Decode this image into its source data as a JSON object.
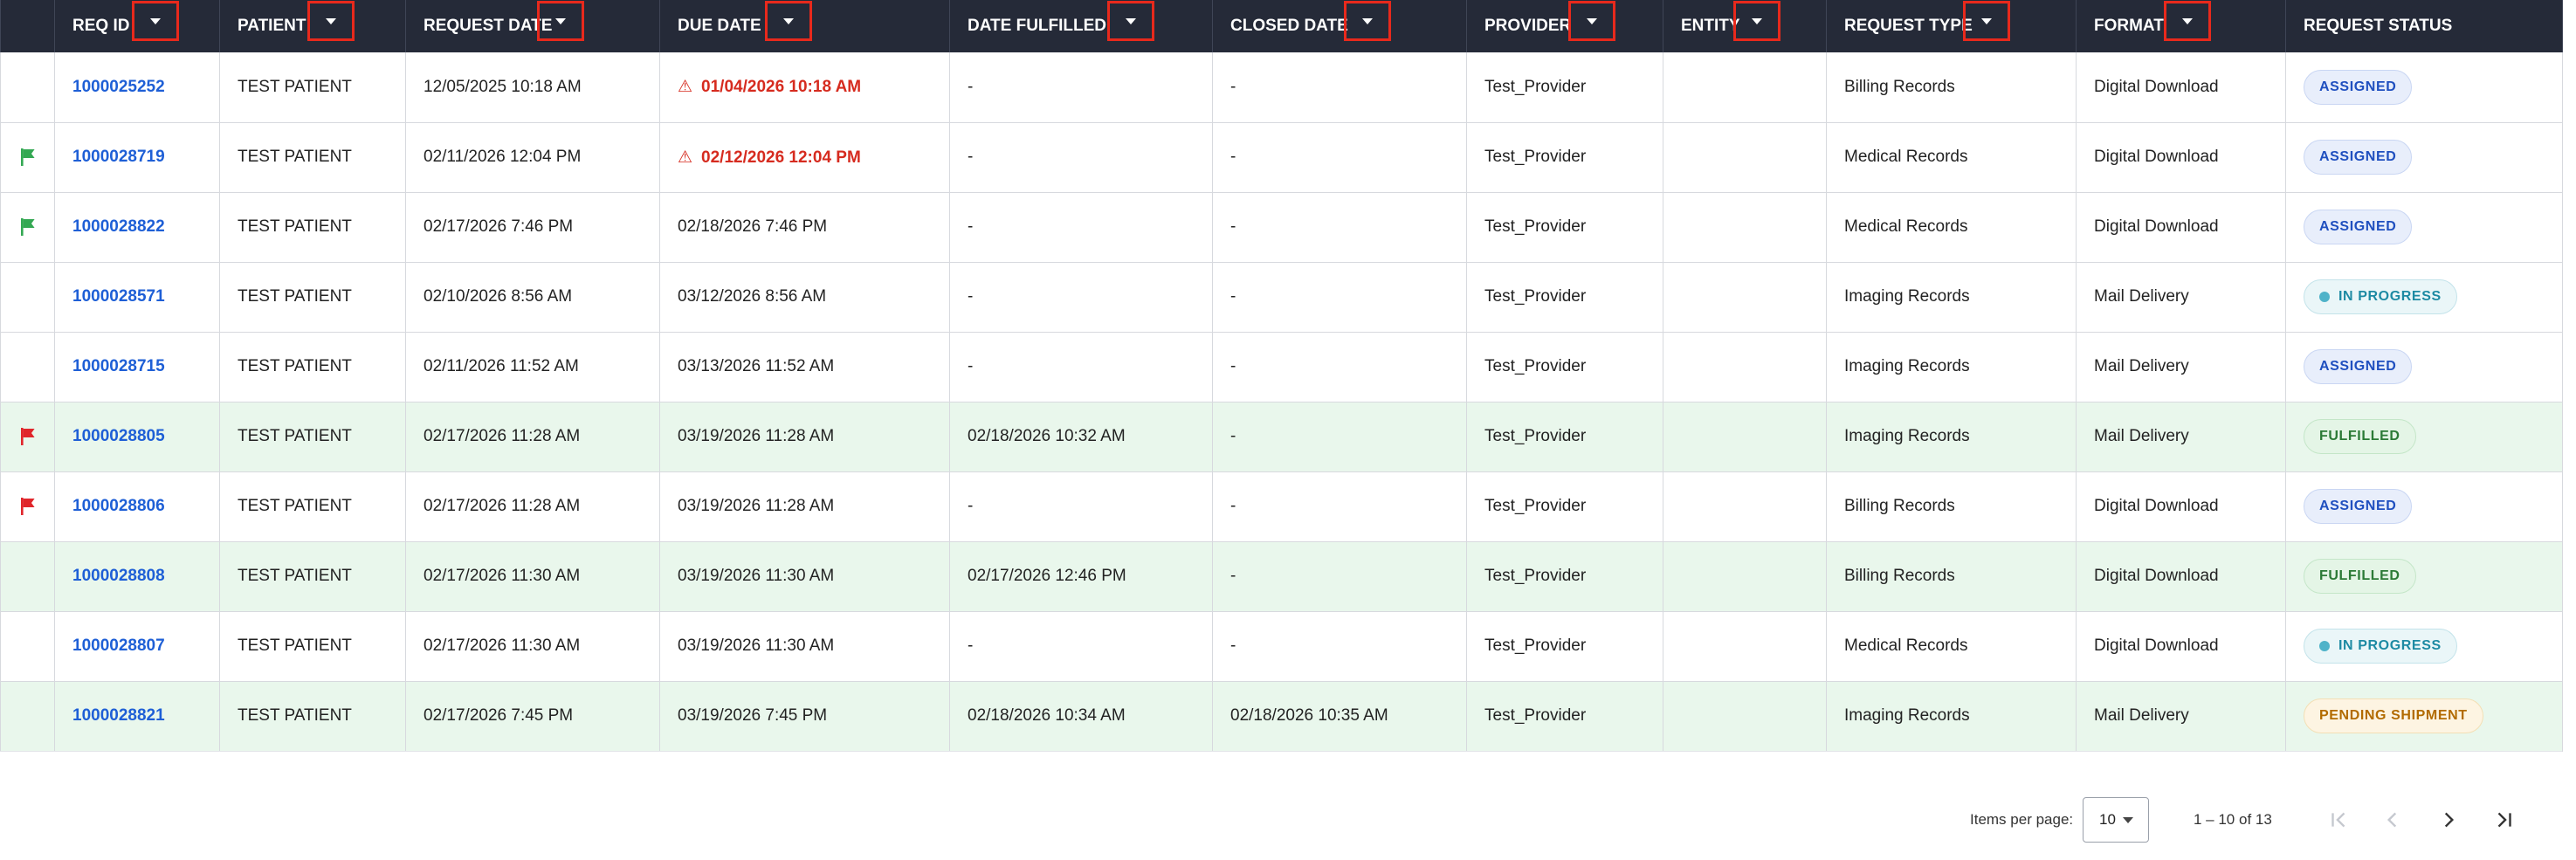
{
  "table": {
    "columns": [
      {
        "key": "flag",
        "label": ""
      },
      {
        "key": "req_id",
        "label": "REQ ID"
      },
      {
        "key": "patient",
        "label": "PATIENT"
      },
      {
        "key": "request_date",
        "label": "REQUEST DATE"
      },
      {
        "key": "due_date",
        "label": "DUE DATE"
      },
      {
        "key": "date_fulfilled",
        "label": "DATE FULFILLED"
      },
      {
        "key": "closed_date",
        "label": "CLOSED DATE"
      },
      {
        "key": "provider",
        "label": "PROVIDER"
      },
      {
        "key": "entity",
        "label": "ENTITY"
      },
      {
        "key": "request_type",
        "label": "REQUEST TYPE"
      },
      {
        "key": "format",
        "label": "FORMAT"
      },
      {
        "key": "request_status",
        "label": "REQUEST STATUS"
      }
    ],
    "rows": [
      {
        "flag": "",
        "req_id": "1000025252",
        "patient": "TEST PATIENT",
        "request_date": "12/05/2025 10:18 AM",
        "due_date": "01/04/2026 10:18 AM",
        "due_overdue": true,
        "date_fulfilled": "-",
        "closed_date": "-",
        "provider": "Test_Provider",
        "entity": "",
        "request_type": "Billing Records",
        "format": "Digital Download",
        "status": "ASSIGNED",
        "status_kind": "assigned",
        "highlight": false
      },
      {
        "flag": "green",
        "req_id": "1000028719",
        "patient": "TEST PATIENT",
        "request_date": "02/11/2026 12:04 PM",
        "due_date": "02/12/2026 12:04 PM",
        "due_overdue": true,
        "date_fulfilled": "-",
        "closed_date": "-",
        "provider": "Test_Provider",
        "entity": "",
        "request_type": "Medical Records",
        "format": "Digital Download",
        "status": "ASSIGNED",
        "status_kind": "assigned",
        "highlight": false
      },
      {
        "flag": "green",
        "req_id": "1000028822",
        "patient": "TEST PATIENT",
        "request_date": "02/17/2026 7:46 PM",
        "due_date": "02/18/2026 7:46 PM",
        "due_overdue": false,
        "date_fulfilled": "-",
        "closed_date": "-",
        "provider": "Test_Provider",
        "entity": "",
        "request_type": "Medical Records",
        "format": "Digital Download",
        "status": "ASSIGNED",
        "status_kind": "assigned",
        "highlight": false
      },
      {
        "flag": "",
        "req_id": "1000028571",
        "patient": "TEST PATIENT",
        "request_date": "02/10/2026 8:56 AM",
        "due_date": "03/12/2026 8:56 AM",
        "due_overdue": false,
        "date_fulfilled": "-",
        "closed_date": "-",
        "provider": "Test_Provider",
        "entity": "",
        "request_type": "Imaging Records",
        "format": "Mail Delivery",
        "status": "IN PROGRESS",
        "status_kind": "in-progress",
        "highlight": false
      },
      {
        "flag": "",
        "req_id": "1000028715",
        "patient": "TEST PATIENT",
        "request_date": "02/11/2026 11:52 AM",
        "due_date": "03/13/2026 11:52 AM",
        "due_overdue": false,
        "date_fulfilled": "-",
        "closed_date": "-",
        "provider": "Test_Provider",
        "entity": "",
        "request_type": "Imaging Records",
        "format": "Mail Delivery",
        "status": "ASSIGNED",
        "status_kind": "assigned",
        "highlight": false
      },
      {
        "flag": "red",
        "req_id": "1000028805",
        "patient": "TEST PATIENT",
        "request_date": "02/17/2026 11:28 AM",
        "due_date": "03/19/2026 11:28 AM",
        "due_overdue": false,
        "date_fulfilled": "02/18/2026 10:32 AM",
        "closed_date": "-",
        "provider": "Test_Provider",
        "entity": "",
        "request_type": "Imaging Records",
        "format": "Mail Delivery",
        "status": "FULFILLED",
        "status_kind": "fulfilled",
        "highlight": true
      },
      {
        "flag": "red",
        "req_id": "1000028806",
        "patient": "TEST PATIENT",
        "request_date": "02/17/2026 11:28 AM",
        "due_date": "03/19/2026 11:28 AM",
        "due_overdue": false,
        "date_fulfilled": "-",
        "closed_date": "-",
        "provider": "Test_Provider",
        "entity": "",
        "request_type": "Billing Records",
        "format": "Digital Download",
        "status": "ASSIGNED",
        "status_kind": "assigned",
        "highlight": false
      },
      {
        "flag": "",
        "req_id": "1000028808",
        "patient": "TEST PATIENT",
        "request_date": "02/17/2026 11:30 AM",
        "due_date": "03/19/2026 11:30 AM",
        "due_overdue": false,
        "date_fulfilled": "02/17/2026 12:46 PM",
        "closed_date": "-",
        "provider": "Test_Provider",
        "entity": "",
        "request_type": "Billing Records",
        "format": "Digital Download",
        "status": "FULFILLED",
        "status_kind": "fulfilled",
        "highlight": true
      },
      {
        "flag": "",
        "req_id": "1000028807",
        "patient": "TEST PATIENT",
        "request_date": "02/17/2026 11:30 AM",
        "due_date": "03/19/2026 11:30 AM",
        "due_overdue": false,
        "date_fulfilled": "-",
        "closed_date": "-",
        "provider": "Test_Provider",
        "entity": "",
        "request_type": "Medical Records",
        "format": "Digital Download",
        "status": "IN PROGRESS",
        "status_kind": "in-progress",
        "highlight": false
      },
      {
        "flag": "",
        "req_id": "1000028821",
        "patient": "TEST PATIENT",
        "request_date": "02/17/2026 7:45 PM",
        "due_date": "03/19/2026 7:45 PM",
        "due_overdue": false,
        "date_fulfilled": "02/18/2026 10:34 AM",
        "closed_date": "02/18/2026 10:35 AM",
        "provider": "Test_Provider",
        "entity": "",
        "request_type": "Imaging Records",
        "format": "Mail Delivery",
        "status": "PENDING SHIPMENT",
        "status_kind": "pending-shipment",
        "highlight": true
      }
    ]
  },
  "icons": {
    "sort": "caret-down-icon",
    "overdue": "warning-triangle-icon",
    "overdue_glyph": "⚠",
    "flag": "flag-icon"
  },
  "colors": {
    "header_bg": "#252a38",
    "highlight_row": "#e9f7ec",
    "link": "#1e5fd6",
    "overdue": "#d62b1f",
    "sort_outline": "#e8291c",
    "flag_green": "#34a853",
    "flag_red": "#e0262b",
    "assigned_bg": "#e8eefb",
    "assigned_border": "#c9d6f3",
    "assigned_text": "#1f4fbf",
    "inprogress_bg": "#eaf6f8",
    "inprogress_border": "#c3e3ea",
    "inprogress_text": "#1d8aa3",
    "inprogress_dot": "#4fb3c9",
    "fulfilled_bg": "#e4f5e6",
    "fulfilled_border": "#c4e6c8",
    "fulfilled_text": "#2b7a36",
    "pending_bg": "#fdf4e2",
    "pending_border": "#f3dfb5",
    "pending_text": "#b26b00"
  },
  "pagination": {
    "items_per_page_label": "Items per page:",
    "items_per_page_value": "10",
    "range_label": "1 – 10 of 13"
  }
}
